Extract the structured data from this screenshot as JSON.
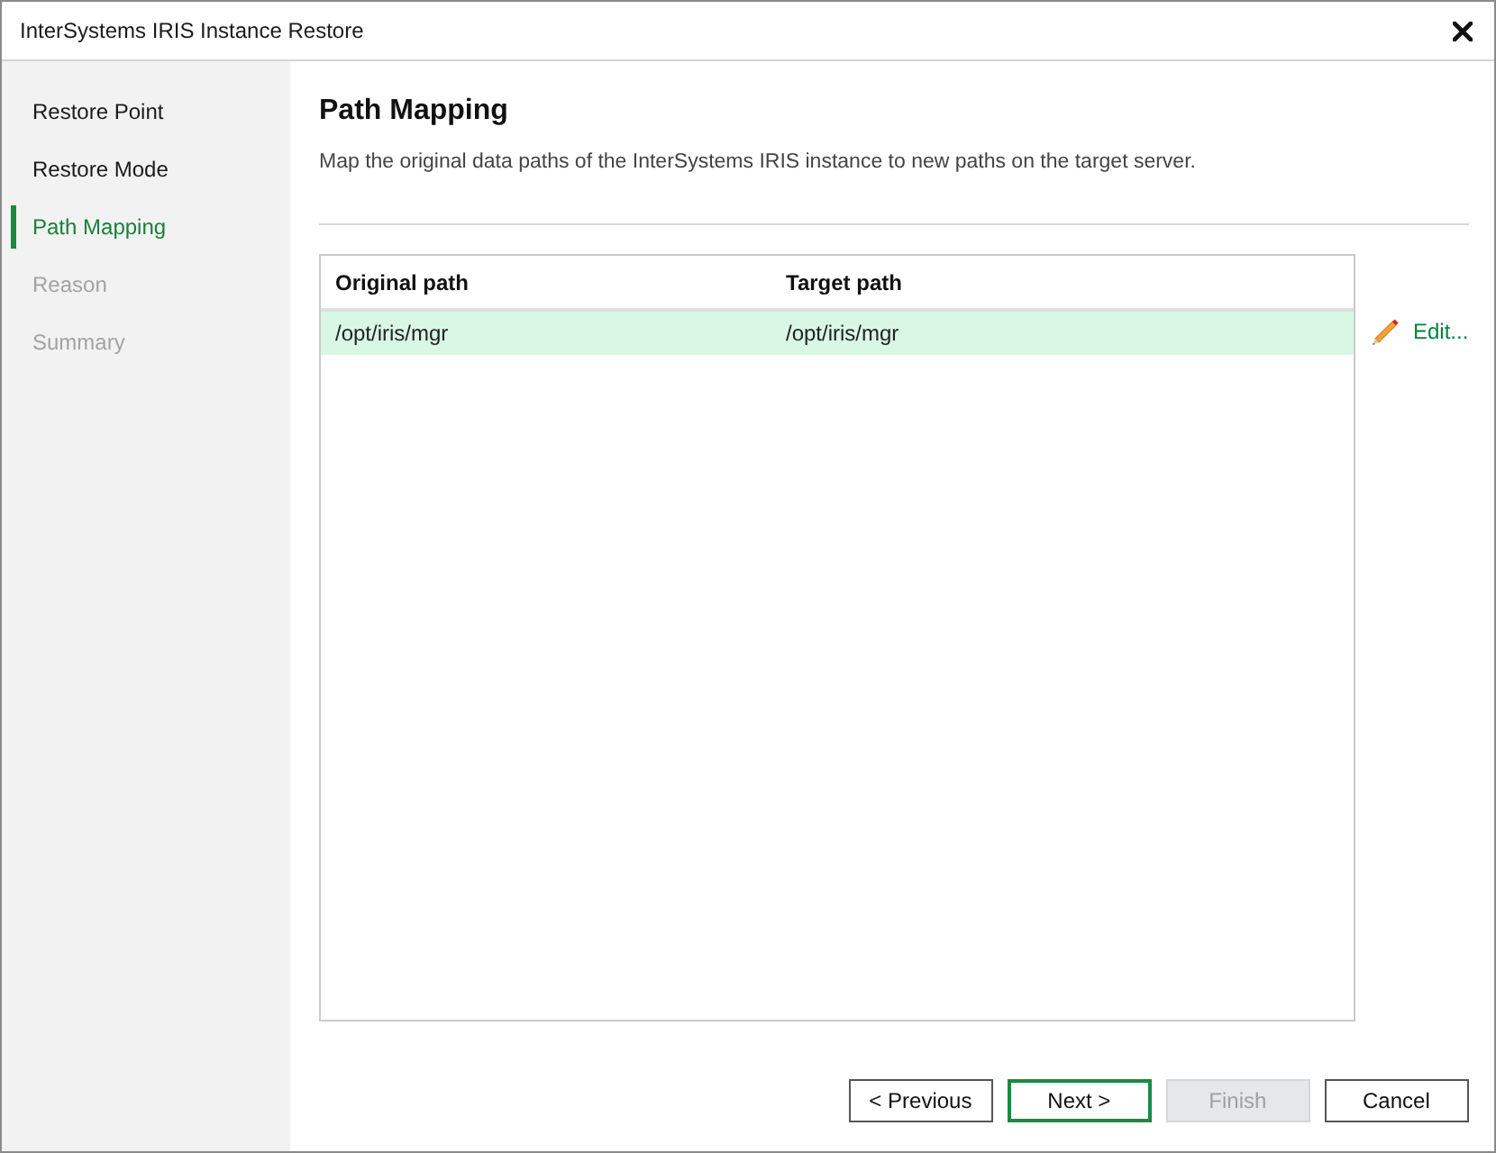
{
  "window": {
    "title": "InterSystems IRIS Instance Restore"
  },
  "sidebar": {
    "steps": [
      {
        "label": "Restore Point",
        "selected": false,
        "disabled": false
      },
      {
        "label": "Restore Mode",
        "selected": false,
        "disabled": false
      },
      {
        "label": "Path Mapping",
        "selected": true,
        "disabled": false
      },
      {
        "label": "Reason",
        "selected": false,
        "disabled": true
      },
      {
        "label": "Summary",
        "selected": false,
        "disabled": true
      }
    ]
  },
  "page": {
    "title": "Path Mapping",
    "description": "Map the original data paths of the InterSystems IRIS instance to new paths on the target server."
  },
  "table": {
    "columns": [
      "Original path",
      "Target path"
    ],
    "rows": [
      {
        "cells": [
          "/opt/iris/mgr",
          "/opt/iris/mgr"
        ],
        "selected": true
      }
    ]
  },
  "edit_link": "Edit...",
  "buttons": [
    {
      "label": "< Previous",
      "focused": false,
      "disabled": false
    },
    {
      "label": "Next >",
      "focused": true,
      "disabled": false
    },
    {
      "label": "Finish",
      "focused": false,
      "disabled": true
    },
    {
      "label": "Cancel",
      "focused": false,
      "disabled": false
    }
  ]
}
